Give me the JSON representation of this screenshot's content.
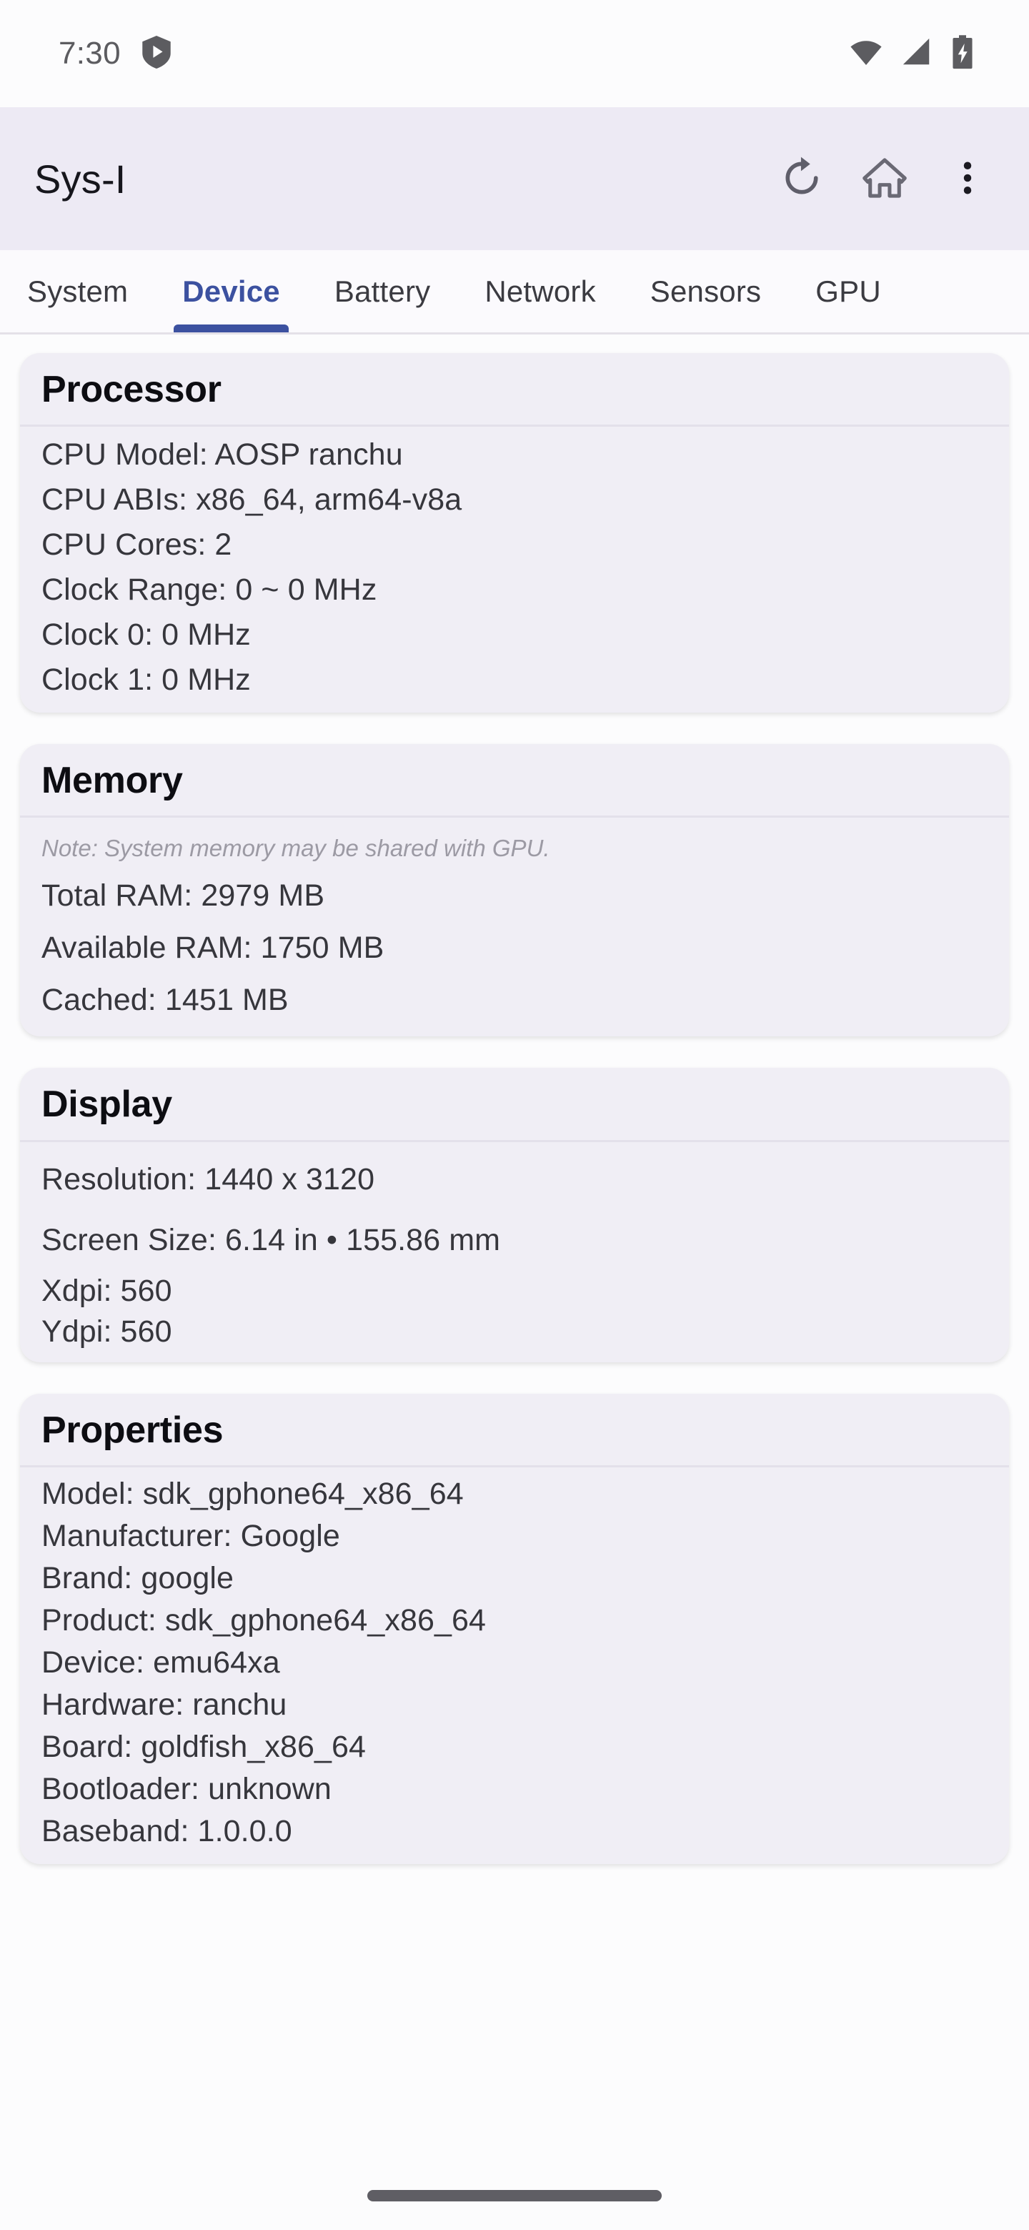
{
  "status_bar": {
    "clock": "7:30",
    "left_icons": [
      {
        "name": "shield-play-icon"
      }
    ],
    "right_icons": [
      {
        "name": "wifi-icon"
      },
      {
        "name": "cellular-signal-icon"
      },
      {
        "name": "battery-charging-icon"
      }
    ]
  },
  "app_bar": {
    "title": "Sys-I",
    "actions": [
      {
        "name": "refresh-icon",
        "label": "Refresh"
      },
      {
        "name": "home-icon",
        "label": "Home"
      },
      {
        "name": "overflow-menu-icon",
        "label": "More options"
      }
    ]
  },
  "tabs": {
    "active_index": 1,
    "items": [
      {
        "label": "System"
      },
      {
        "label": "Device"
      },
      {
        "label": "Battery"
      },
      {
        "label": "Network"
      },
      {
        "label": "Sensors"
      },
      {
        "label": "GPU"
      }
    ]
  },
  "cards": {
    "processor": {
      "title": "Processor",
      "rows": [
        "CPU Model: AOSP ranchu",
        "CPU ABIs: x86_64, arm64-v8a",
        "CPU Cores: 2",
        "Clock Range: 0 ~ 0 MHz",
        "Clock 0: 0 MHz",
        "Clock 1: 0 MHz"
      ]
    },
    "memory": {
      "title": "Memory",
      "note": "Note: System memory may be shared with GPU.",
      "rows": [
        "Total RAM: 2979 MB",
        "Available RAM: 1750 MB",
        "Cached: 1451 MB"
      ]
    },
    "display": {
      "title": "Display",
      "rows": [
        "Resolution: 1440 x 3120",
        "Screen Size: 6.14 in • 155.86 mm",
        "Xdpi: 560",
        "Ydpi: 560"
      ]
    },
    "properties": {
      "title": "Properties",
      "rows": [
        "Model: sdk_gphone64_x86_64",
        "Manufacturer: Google",
        "Brand: google",
        "Product: sdk_gphone64_x86_64",
        "Device: emu64xa",
        "Hardware: ranchu",
        "Board: goldfish_x86_64",
        "Bootloader: unknown",
        "Baseband: 1.0.0.0"
      ]
    }
  },
  "nav_bar": {
    "handle": "gesture-home-handle"
  },
  "colors": {
    "accent": "#3C51A0",
    "app_bar_bg": "#EDEAF4",
    "card_bg": "#F0EEF5",
    "page_bg": "#FCFCFD",
    "body_text": "#36363C",
    "note_text": "#9C9AA4"
  }
}
